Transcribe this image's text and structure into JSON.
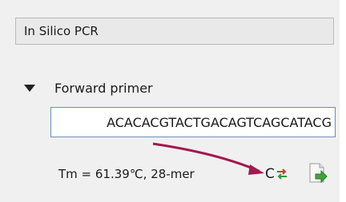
{
  "panel": {
    "title": "In Silico PCR"
  },
  "forward_primer": {
    "section_label": "Forward primer",
    "sequence_value": "ACACACGTACTGACAGTCAGCATACG",
    "tm_text": "Tm = 61.39℃, 28-mer"
  },
  "toolbar": {
    "complement_label": "C",
    "icons": [
      "expand-triangle-icon",
      "swap-arrows-icon",
      "document-arrow-icon"
    ]
  },
  "annotation": {
    "arrow_color": "#a0194f"
  },
  "colors": {
    "swap_red": "#d23a2a",
    "swap_green": "#2e9a3a",
    "input_border": "#6a8fb8"
  }
}
